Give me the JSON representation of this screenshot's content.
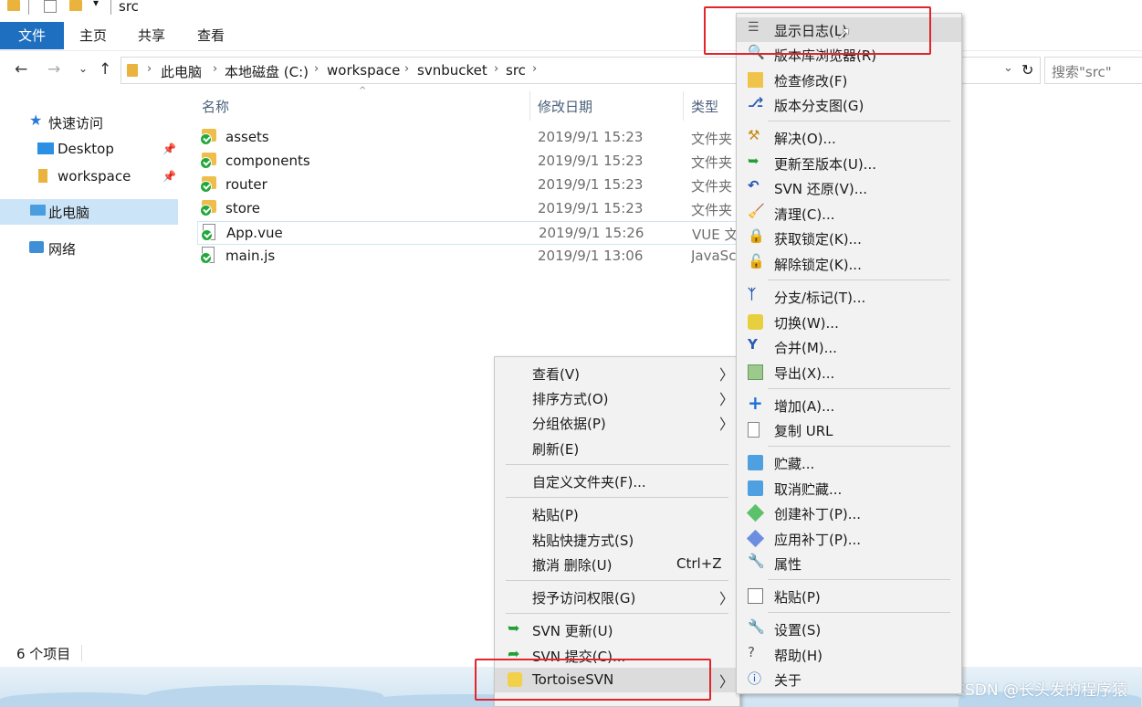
{
  "window": {
    "title": "src"
  },
  "ribbon": {
    "tabs": [
      "文件",
      "主页",
      "共享",
      "查看"
    ]
  },
  "address": {
    "crumbs": [
      "此电脑",
      "本地磁盘 (C:)",
      "workspace",
      "svnbucket",
      "src"
    ],
    "search_placeholder": "搜索\"src\""
  },
  "sidebar": {
    "items": [
      {
        "label": "快速访问",
        "icon": "star-icon"
      },
      {
        "label": "Desktop",
        "icon": "desktop-icon"
      },
      {
        "label": "workspace",
        "icon": "folder-icon"
      },
      {
        "label": "此电脑",
        "icon": "computer-icon"
      },
      {
        "label": "网络",
        "icon": "network-icon"
      }
    ]
  },
  "filelist": {
    "columns": [
      "名称",
      "修改日期",
      "类型"
    ],
    "rows": [
      {
        "name": "assets",
        "date": "2019/9/1 15:23",
        "type": "文件夹",
        "icon": "folder-icon"
      },
      {
        "name": "components",
        "date": "2019/9/1 15:23",
        "type": "文件夹",
        "icon": "folder-icon"
      },
      {
        "name": "router",
        "date": "2019/9/1 15:23",
        "type": "文件夹",
        "icon": "folder-icon"
      },
      {
        "name": "store",
        "date": "2019/9/1 15:23",
        "type": "文件夹",
        "icon": "folder-icon"
      },
      {
        "name": "App.vue",
        "date": "2019/9/1 15:26",
        "type": "VUE 文",
        "icon": "file-icon"
      },
      {
        "name": "main.js",
        "date": "2019/9/1 13:06",
        "type": "JavaSc",
        "icon": "js-file-icon"
      }
    ]
  },
  "status": {
    "count": "6 个项目"
  },
  "menu1": {
    "items": [
      {
        "label": "查看(V)",
        "submenu": true
      },
      {
        "label": "排序方式(O)",
        "submenu": true
      },
      {
        "label": "分组依据(P)",
        "submenu": true
      },
      {
        "label": "刷新(E)"
      },
      {
        "label": "自定义文件夹(F)..."
      },
      {
        "label": "粘贴(P)"
      },
      {
        "label": "粘贴快捷方式(S)"
      },
      {
        "label": "撤消 删除(U)",
        "shortcut": "Ctrl+Z"
      },
      {
        "label": "授予访问权限(G)",
        "submenu": true
      },
      {
        "label": "SVN 更新(U)"
      },
      {
        "label": "SVN 提交(C)..."
      },
      {
        "label": "TortoiseSVN",
        "submenu": true
      }
    ]
  },
  "menu2": {
    "items": [
      {
        "label": "显示日志(L)",
        "icon": "log-icon"
      },
      {
        "label": "版本库浏览器(R)",
        "icon": "repo-browser-icon"
      },
      {
        "label": "检查修改(F)",
        "icon": "check-modifications-icon"
      },
      {
        "label": "版本分支图(G)",
        "icon": "revision-graph-icon"
      },
      {
        "label": "解决(O)...",
        "icon": "resolve-icon"
      },
      {
        "label": "更新至版本(U)...",
        "icon": "update-to-revision-icon"
      },
      {
        "label": "SVN 还原(V)...",
        "icon": "revert-icon"
      },
      {
        "label": "清理(C)...",
        "icon": "cleanup-icon"
      },
      {
        "label": "获取锁定(K)...",
        "icon": "lock-icon"
      },
      {
        "label": "解除锁定(K)...",
        "icon": "unlock-icon"
      },
      {
        "label": "分支/标记(T)...",
        "icon": "branch-icon"
      },
      {
        "label": "切换(W)...",
        "icon": "switch-icon"
      },
      {
        "label": "合并(M)...",
        "icon": "merge-icon"
      },
      {
        "label": "导出(X)...",
        "icon": "export-icon"
      },
      {
        "label": "增加(A)...",
        "icon": "add-icon"
      },
      {
        "label": "复制 URL",
        "icon": "copy-url-icon"
      },
      {
        "label": "贮藏...",
        "icon": "shelve-icon"
      },
      {
        "label": "取消贮藏...",
        "icon": "unshelve-icon"
      },
      {
        "label": "创建补丁(P)...",
        "icon": "create-patch-icon"
      },
      {
        "label": "应用补丁(P)...",
        "icon": "apply-patch-icon"
      },
      {
        "label": "属性",
        "icon": "properties-icon"
      },
      {
        "label": "粘贴(P)",
        "icon": "paste-icon"
      },
      {
        "label": "设置(S)",
        "icon": "settings-icon"
      },
      {
        "label": "帮助(H)",
        "icon": "help-icon"
      },
      {
        "label": "关于",
        "icon": "about-icon"
      }
    ]
  },
  "watermark": "CSDN @长头发的程序猿",
  "colors": {
    "accent": "#1f6fc1",
    "highlight_box": "#e0262a"
  }
}
